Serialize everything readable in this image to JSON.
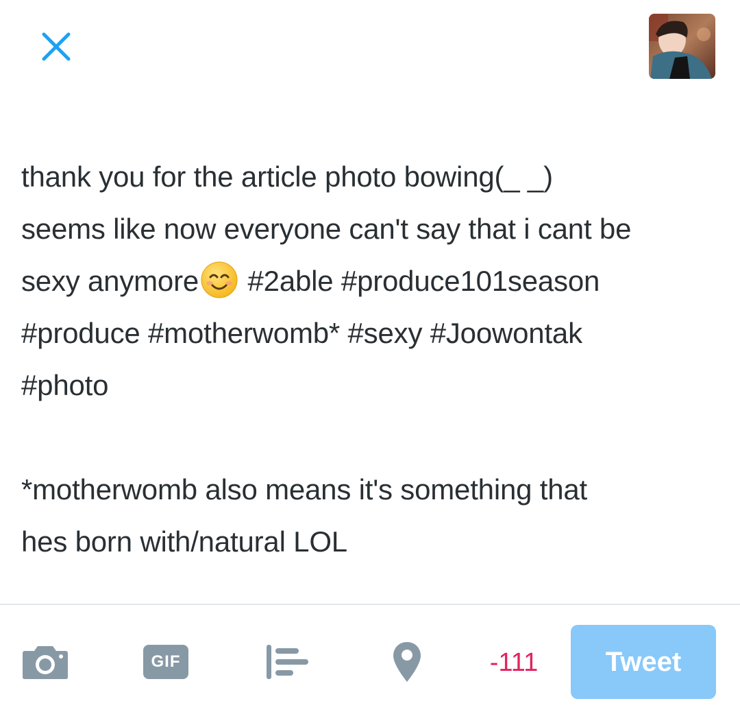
{
  "header": {
    "close_icon": "close-icon",
    "avatar_icon": "user-avatar"
  },
  "compose": {
    "line1": "thank you for the article photo bowing(_ _)",
    "line2": "seems like now everyone can't say that i cant be",
    "line3_pre": "sexy anymore",
    "line3_emoji": "smiling-face-emoji",
    "line3_post": " #2able #produce101season",
    "line4": "#produce #motherwomb* #sexy #Joowontak",
    "line5": "#photo",
    "note_line1": "*motherwomb also means it's something that",
    "note_line2": "hes born with/natural LOL"
  },
  "toolbar": {
    "camera_icon": "camera-icon",
    "gif_label": "GIF",
    "poll_icon": "poll-icon",
    "location_icon": "location-pin-icon",
    "char_counter": "-111",
    "tweet_label": "Tweet"
  },
  "colors": {
    "accent": "#1da1f2",
    "tweet_button_disabled": "#88c9f9",
    "counter_over_limit": "#e0245e",
    "icon_gray": "#8899a6",
    "text": "#292f33",
    "divider": "#e1e8ed"
  }
}
